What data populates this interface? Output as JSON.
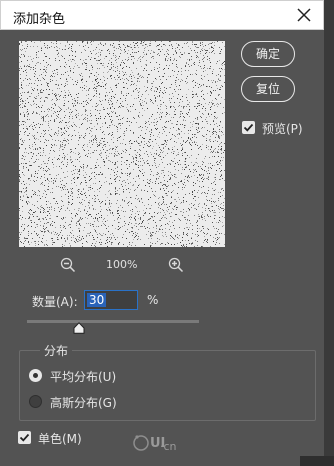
{
  "window": {
    "title": "添加杂色"
  },
  "buttons": {
    "ok": "确定",
    "reset": "复位"
  },
  "preview_checkbox": {
    "label": "预览(P)",
    "checked": true
  },
  "zoom": {
    "level": "100%"
  },
  "amount": {
    "label": "数量(A):",
    "value": "30",
    "unit": "%",
    "fraction": 0.3
  },
  "distribution": {
    "title": "分布",
    "options": [
      {
        "label": "平均分布(U)",
        "selected": true
      },
      {
        "label": "高斯分布(G)",
        "selected": false
      }
    ]
  },
  "monochromatic": {
    "label": "单色(M)",
    "checked": true
  },
  "watermark": {
    "text": "UI",
    "suffix": "·cn"
  },
  "colors": {
    "dialog_bg": "#535353",
    "accent": "#2a63b8",
    "titlebar": "#ffffff"
  },
  "icons": [
    "close-icon",
    "zoom-out-icon",
    "zoom-in-icon",
    "checkmark-icon",
    "slider-thumb-icon"
  ]
}
